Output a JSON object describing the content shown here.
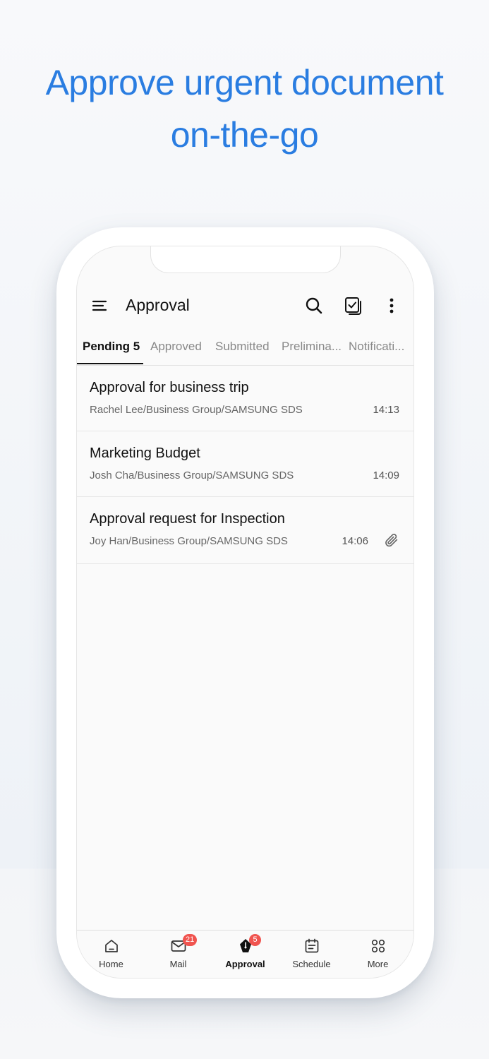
{
  "headline": {
    "line1": "Approve urgent document",
    "line2": "on-the-go"
  },
  "appbar": {
    "title": "Approval",
    "icons": [
      "menu-icon",
      "search-icon",
      "approve-document-icon",
      "more-vert-icon"
    ]
  },
  "tabs": [
    {
      "label": "Pending 5",
      "active": true
    },
    {
      "label": "Approved"
    },
    {
      "label": "Submitted"
    },
    {
      "label": "Prelimina..."
    },
    {
      "label": "Notificati..."
    }
  ],
  "items": [
    {
      "title": "Approval for business trip",
      "sender": "Rachel Lee/Business Group/SAMSUNG SDS",
      "time": "14:13",
      "attachment": false
    },
    {
      "title": "Marketing Budget",
      "sender": "Josh Cha/Business Group/SAMSUNG SDS",
      "time": "14:09",
      "attachment": false
    },
    {
      "title": "Approval request for Inspection",
      "sender": "Joy Han/Business Group/SAMSUNG SDS",
      "time": "14:06",
      "attachment": true
    }
  ],
  "bottom_nav": [
    {
      "label": "Home",
      "icon": "home-icon"
    },
    {
      "label": "Mail",
      "icon": "mail-icon",
      "badge": "21"
    },
    {
      "label": "Approval",
      "icon": "approval-pen-icon",
      "badge": "5",
      "active": true
    },
    {
      "label": "Schedule",
      "icon": "calendar-icon"
    },
    {
      "label": "More",
      "icon": "grid-icon"
    }
  ],
  "colors": {
    "headline": "#2a7de1",
    "badge": "#f0544f"
  }
}
